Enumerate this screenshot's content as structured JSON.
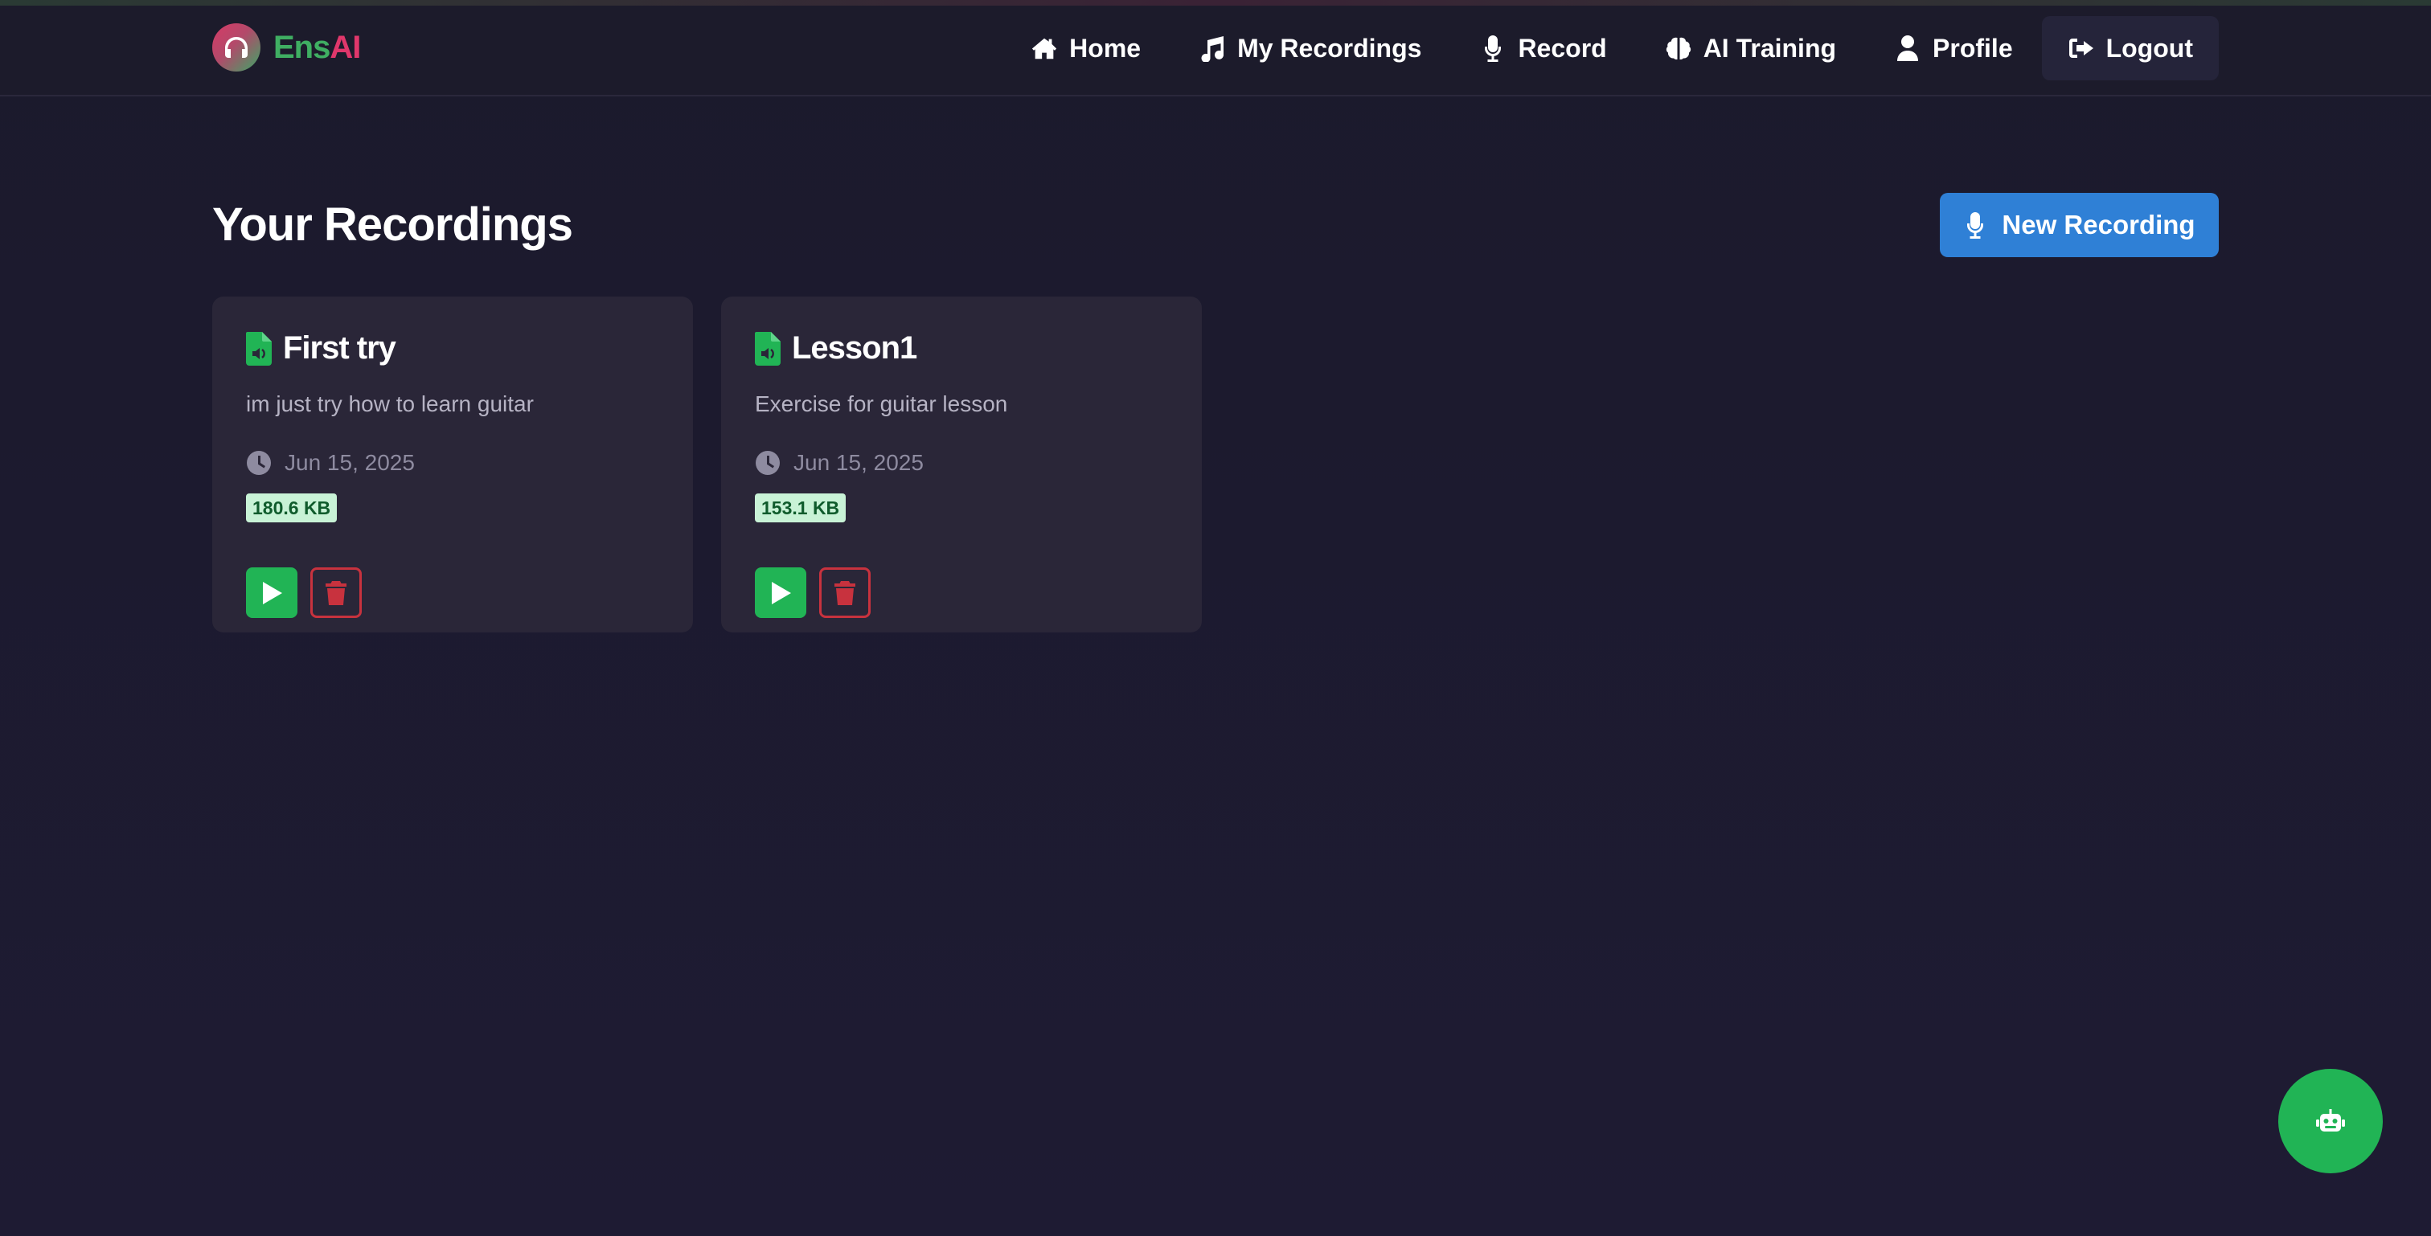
{
  "brand": {
    "name_part1": "Ens",
    "name_part2": "AI"
  },
  "nav": {
    "items": [
      {
        "label": "Home",
        "icon": "home-icon"
      },
      {
        "label": "My Recordings",
        "icon": "music-icon"
      },
      {
        "label": "Record",
        "icon": "microphone-icon"
      },
      {
        "label": "AI Training",
        "icon": "brain-icon"
      },
      {
        "label": "Profile",
        "icon": "user-icon"
      },
      {
        "label": "Logout",
        "icon": "logout-icon"
      }
    ]
  },
  "main": {
    "title": "Your Recordings",
    "new_button": "New Recording",
    "recordings": [
      {
        "title": "First try",
        "description": "im just try how to learn guitar",
        "date": "Jun 15, 2025",
        "size": "180.6 KB"
      },
      {
        "title": "Lesson1",
        "description": "Exercise for guitar lesson",
        "date": "Jun 15, 2025",
        "size": "153.1 KB"
      }
    ]
  },
  "colors": {
    "background": "#1c1a2e",
    "card": "#2a2638",
    "accent_blue": "#2f80d6",
    "accent_green": "#21b455",
    "danger_red": "#c8323e",
    "brand_green": "#3fae62",
    "brand_pink": "#e0376b"
  },
  "assistant": {
    "icon": "robot-icon"
  }
}
